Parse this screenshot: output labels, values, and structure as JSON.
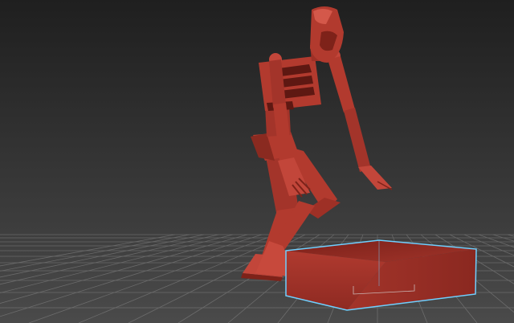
{
  "viewport": {
    "view": "perspective",
    "background_top": "#1f1f1f",
    "background_bottom": "#4a4a4a",
    "grid_color": "#8a8a8a",
    "figure_color": "#b23a2e",
    "figure_shade": "#7e2219",
    "figure_highlight": "#d4584a",
    "box_color": "#a8352b",
    "box_shade": "#7a221b",
    "selection_color": "#6fd0ff"
  },
  "scene": {
    "objects": [
      {
        "name": "biped",
        "icon": "biped-figure"
      },
      {
        "name": "box",
        "icon": "box-primitive",
        "selected": true
      }
    ]
  }
}
